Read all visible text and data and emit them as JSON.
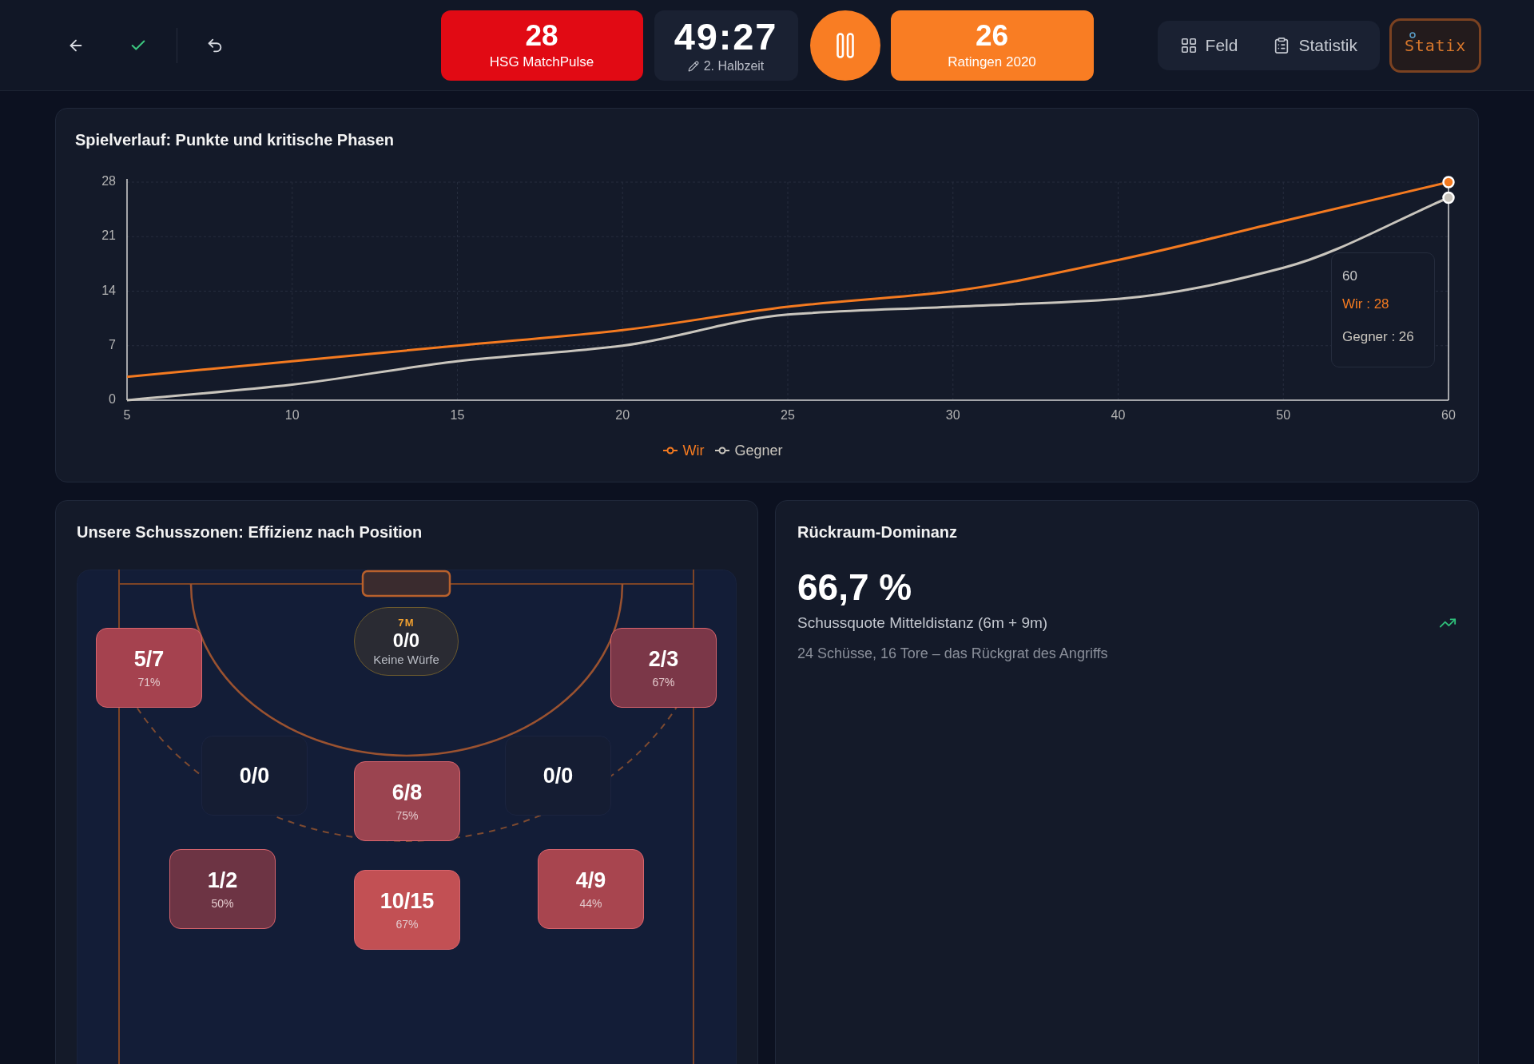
{
  "scoreboard": {
    "home": {
      "score": "28",
      "team": "HSG MatchPulse"
    },
    "clock": {
      "time": "49:27",
      "period": "2. Halbzeit",
      "running": true
    },
    "away": {
      "score": "26",
      "team": "Ratingen 2020"
    }
  },
  "nav": {
    "items": [
      {
        "label": "Feld",
        "selected": false
      },
      {
        "label": "Statistik",
        "selected": false
      }
    ]
  },
  "brand": {
    "name": "Statix"
  },
  "progress_chart": {
    "title": "Spielverlauf: Punkte und kritische Phasen",
    "chart_data": {
      "type": "line",
      "categories": [
        "5",
        "10",
        "15",
        "20",
        "25",
        "30",
        "40",
        "50",
        "60"
      ],
      "series": [
        {
          "name": "Wir",
          "color": "#f47a20",
          "values": [
            3,
            5,
            7,
            9,
            12,
            14,
            18,
            23,
            28
          ]
        },
        {
          "name": "Gegner",
          "color": "#c9c5bd",
          "values": [
            0,
            2,
            5,
            7,
            11,
            12,
            13,
            17,
            26
          ]
        }
      ],
      "ylim": [
        0,
        28
      ],
      "yticks": [
        0,
        7,
        14,
        21,
        28
      ],
      "grid": true
    },
    "tooltip": {
      "title": "60",
      "rows": [
        {
          "text": "Wir : 28",
          "color": "#f47a20"
        },
        {
          "text": "Gegner : 26",
          "color": "#c9c5bd"
        }
      ]
    }
  },
  "shot_zones": {
    "title": "Unsere Schusszonen: Effizienz nach Position",
    "zones": [
      {
        "kind": "zone",
        "ratio": "5/7",
        "percent": "71%",
        "color": "#a5424f"
      },
      {
        "kind": "penalty",
        "tag": "7M",
        "ratio": "0/0",
        "note": "Keine Würfe",
        "color": "#2a2b33"
      },
      {
        "kind": "zone",
        "ratio": "2/3",
        "percent": "67%",
        "color": "#7b3748"
      },
      {
        "kind": "empty",
        "ratio": "0/0",
        "color": "#151d33"
      },
      {
        "kind": "zone",
        "ratio": "6/8",
        "percent": "75%",
        "color": "#9b4450"
      },
      {
        "kind": "empty",
        "ratio": "0/0",
        "color": "#151d33"
      },
      {
        "kind": "zone",
        "ratio": "1/2",
        "percent": "50%",
        "color": "#6d3444"
      },
      {
        "kind": "zone",
        "ratio": "10/15",
        "percent": "67%",
        "color": "#c25054"
      },
      {
        "kind": "zone",
        "ratio": "4/9",
        "percent": "44%",
        "color": "#a8454f"
      }
    ]
  },
  "dominance": {
    "title": "Rückraum-Dominanz",
    "value": "66,7 %",
    "label": "Schussquote Mitteldistanz (6m + 9m)",
    "rising": true,
    "detail": "24 Schüsse, 16 Tore – das Rückgrat des Angriffs"
  }
}
